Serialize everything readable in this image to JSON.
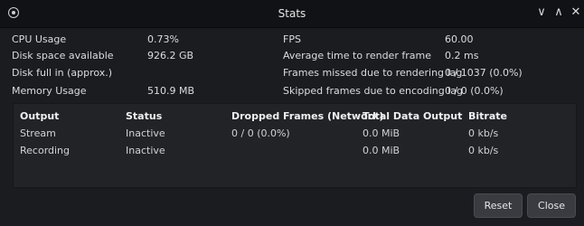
{
  "window": {
    "title": "Stats",
    "controls": {
      "minimize": "∨",
      "maximize": "∧",
      "close": "✕"
    }
  },
  "stats_left": [
    {
      "label": "CPU Usage",
      "value": "0.73%"
    },
    {
      "label": "Disk space available",
      "value": "926.2 GB"
    },
    {
      "label": "Disk full in (approx.)",
      "value": ""
    },
    {
      "label": "Memory Usage",
      "value": "510.9 MB"
    }
  ],
  "stats_right": [
    {
      "label": "FPS",
      "value": "60.00"
    },
    {
      "label": "Average time to render frame",
      "value": "0.2 ms"
    },
    {
      "label": "Frames missed due to rendering lag",
      "value": "0 / 1037 (0.0%)"
    },
    {
      "label": "Skipped frames due to encoding lag",
      "value": "0 / 0 (0.0%)"
    }
  ],
  "output_table": {
    "columns": [
      "Output",
      "Status",
      "Dropped Frames (Network)",
      "Total Data Output",
      "Bitrate"
    ],
    "rows": [
      [
        "Stream",
        "Inactive",
        "0 / 0 (0.0%)",
        "0.0 MiB",
        "0 kb/s"
      ],
      [
        "Recording",
        "Inactive",
        "",
        "0.0 MiB",
        "0 kb/s"
      ]
    ]
  },
  "buttons": {
    "reset": "Reset",
    "close": "Close"
  }
}
